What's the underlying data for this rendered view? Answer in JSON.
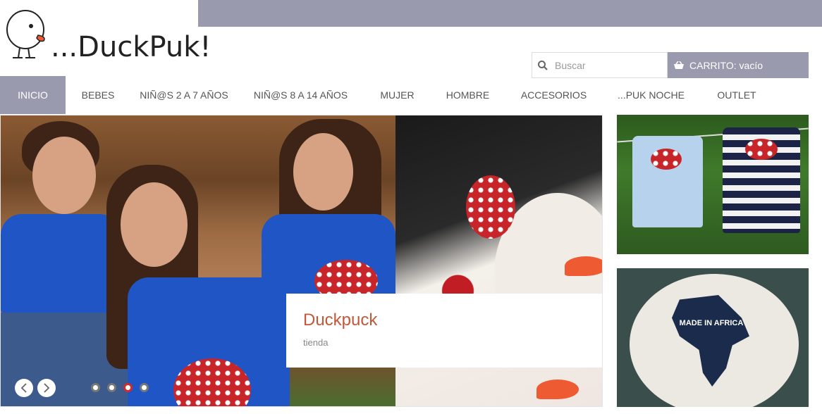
{
  "brand": {
    "logo_text": "...DuckPuk!"
  },
  "header": {
    "search_placeholder": "Buscar",
    "cart_label": "CARRITO: vacío"
  },
  "nav": {
    "items": [
      {
        "label": "INICIO",
        "active": true
      },
      {
        "label": "BEBES"
      },
      {
        "label": "NIÑ@S 2 A 7 AÑOS"
      },
      {
        "label": "NIÑ@S 8 A 14 AÑOS"
      },
      {
        "label": "MUJER"
      },
      {
        "label": "HOMBRE"
      },
      {
        "label": "ACCESORIOS"
      },
      {
        "label": "...PUK NOCHE"
      },
      {
        "label": "OUTLET"
      }
    ]
  },
  "slider": {
    "caption_title": "Duckpuck",
    "caption_subtitle": "tienda",
    "dot_count": 4,
    "active_dot": 3
  },
  "side": {
    "img2_text": "MADE IN AFRICA"
  },
  "colors": {
    "accent": "#9a9aae",
    "caption_title": "#c0593c",
    "active_dot": "#d52a2a"
  }
}
